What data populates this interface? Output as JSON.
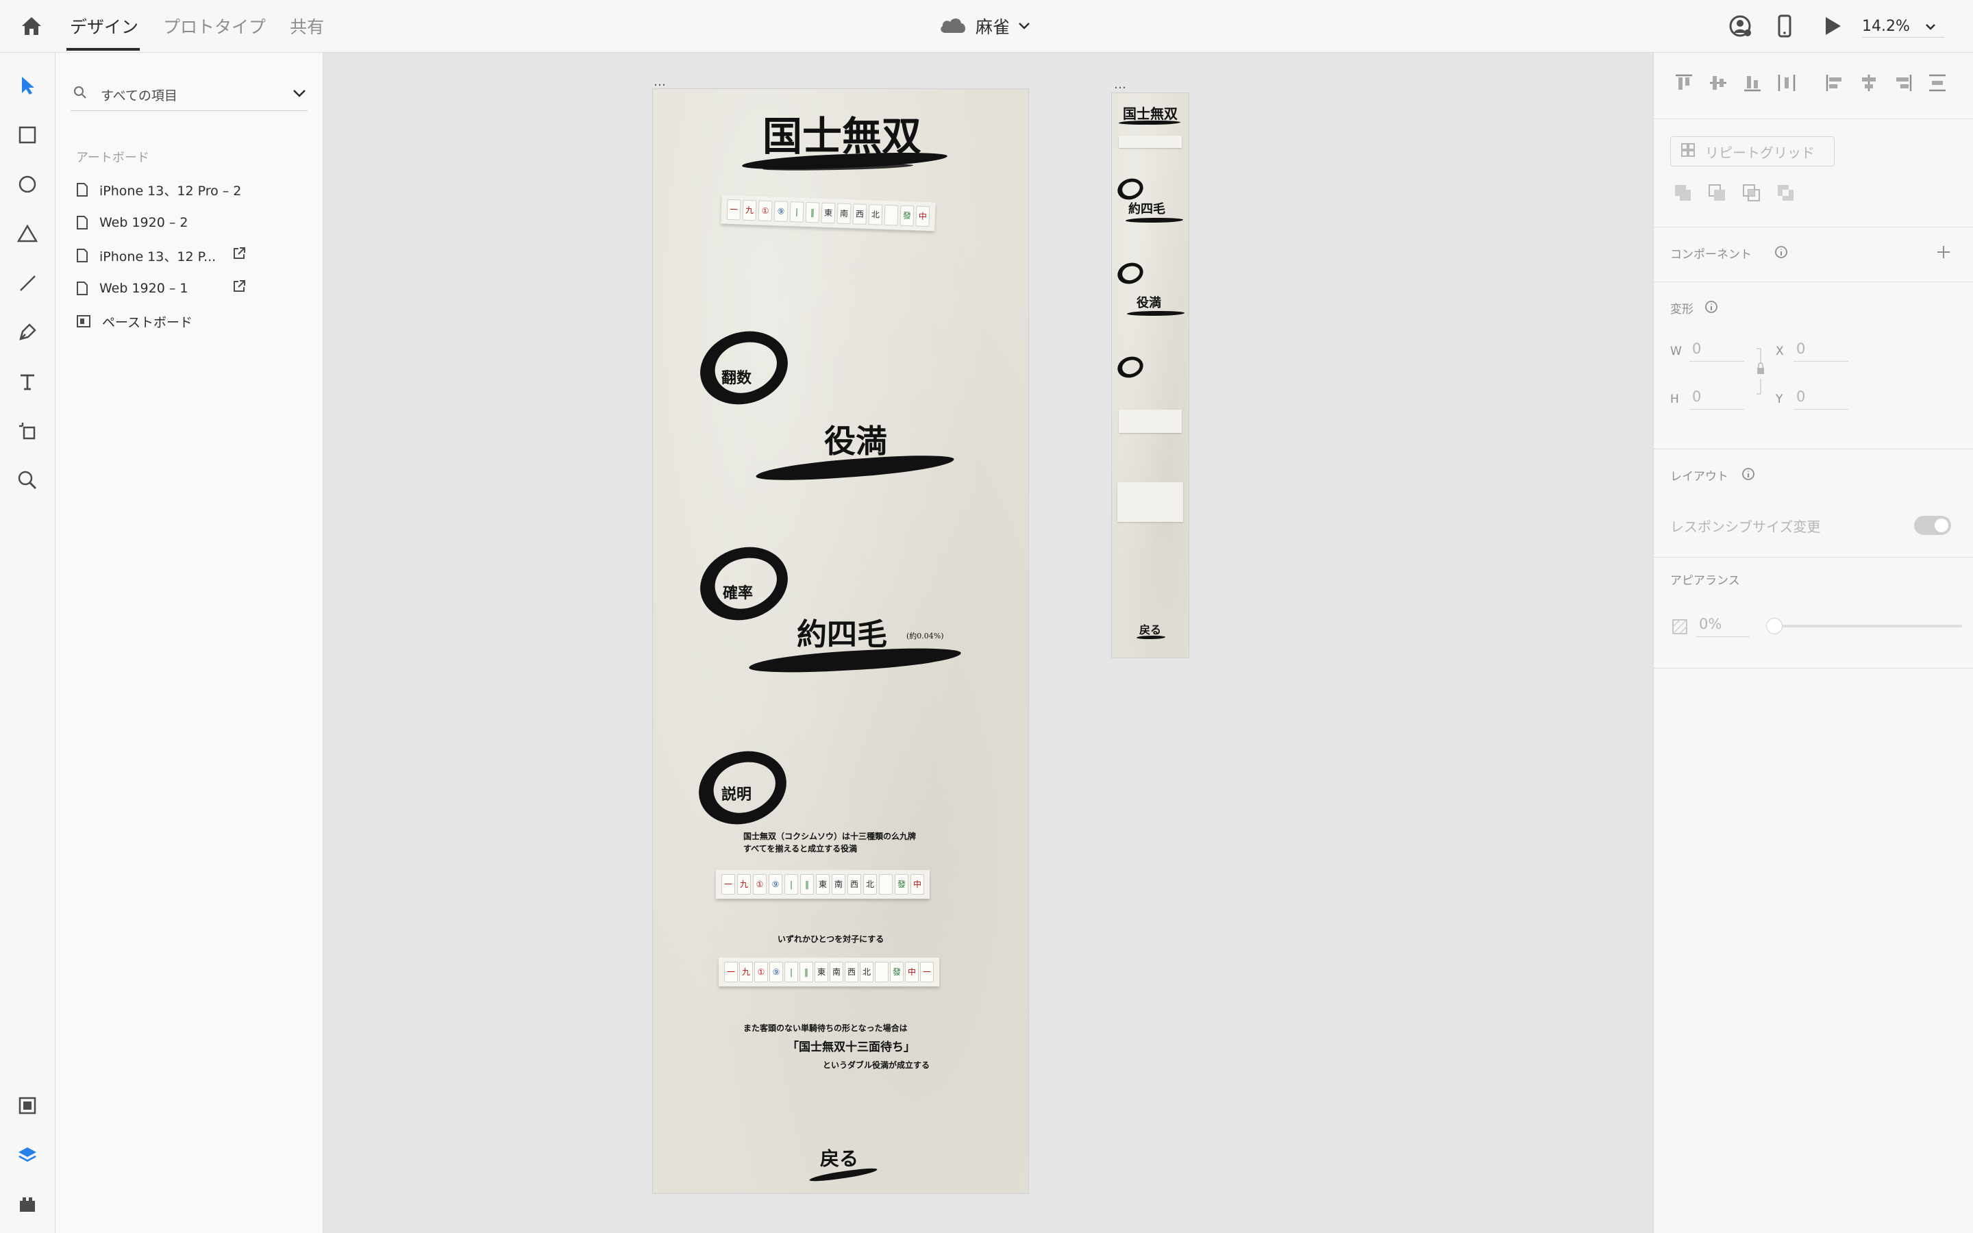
{
  "topbar": {
    "tabs": [
      "デザイン",
      "プロトタイプ",
      "共有"
    ],
    "document_title": "麻雀",
    "zoom": "14.2%"
  },
  "layers": {
    "search_placeholder": "すべての項目",
    "section_label": "アートボード",
    "items": [
      {
        "label": "iPhone 13、12 Pro – 2",
        "icon": "page-icon"
      },
      {
        "label": "Web 1920 – 2",
        "icon": "page-icon"
      },
      {
        "label": "iPhone 13、12 P...",
        "icon": "page-icon",
        "linked": true
      },
      {
        "label": "Web 1920 – 1",
        "icon": "page-icon",
        "linked": true
      },
      {
        "label": "ペーストボード",
        "icon": "pasteboard-icon"
      }
    ]
  },
  "props": {
    "repeat_grid": "リピートグリッド",
    "component": "コンポーネント",
    "transform": "変形",
    "w_label": "W",
    "w_value": "0",
    "x_label": "X",
    "x_value": "0",
    "h_label": "H",
    "h_value": "0",
    "y_label": "Y",
    "y_value": "0",
    "layout": "レイアウト",
    "responsive": "レスポンシブサイズ変更",
    "responsive_on": true,
    "appearance": "アピアランス",
    "opacity": "0%"
  },
  "canvas": {
    "main": {
      "title": "国士無双",
      "section1_label": "翻数",
      "section1_value": "役満",
      "section2_label": "確率",
      "section2_value": "約四毛",
      "section2_note": "(約0.04%)",
      "section3_label": "説明",
      "desc_line1": "国士無双（コクシムソウ）は十三種類の么九牌",
      "desc_line2": "すべてを揃えると成立する役満",
      "pair_text": "いずれかひとつを対子にする",
      "double_line1": "また客頭のない単騎待ちの形となった場合は",
      "double_line2": "「国士無双十三面待ち」",
      "double_line3": "というダブル役満が成立する",
      "back": "戻る",
      "tiles": [
        "一萬",
        "九萬",
        "①",
        "⑨",
        "|",
        "‖",
        "東",
        "南",
        "西",
        "北",
        "",
        "發",
        "中"
      ],
      "tiles_extra": [
        "一萬",
        "九萬",
        "①",
        "⑨",
        "|",
        "‖",
        "東",
        "南",
        "西",
        "北",
        "",
        "發",
        "中",
        "一萬"
      ]
    },
    "mini": {
      "title": "国士無双",
      "value1": "約四毛",
      "value2": "役満",
      "back": "戻る"
    }
  },
  "colors": {
    "accent": "#2680eb",
    "ink": "#111111",
    "paper": "#e3e1d8"
  }
}
